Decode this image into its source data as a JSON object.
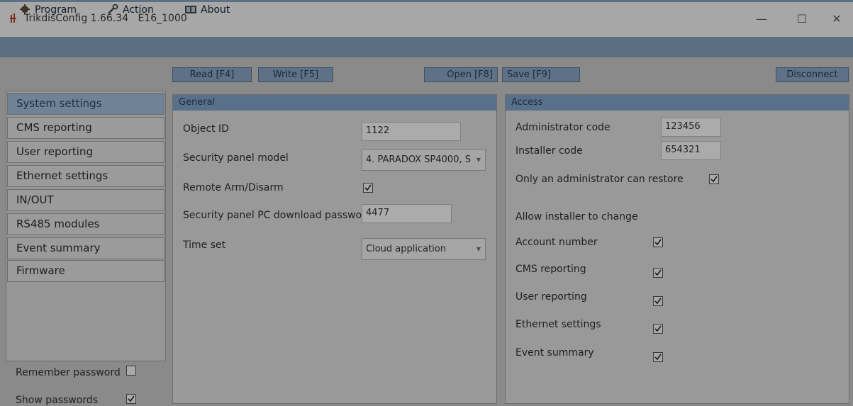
{
  "window": {
    "title": "TrikdisConfig 1.66.34",
    "device": "E16_1000",
    "minimize_glyph": "—",
    "maximize_glyph": "☐",
    "close_glyph": "✕"
  },
  "menu": {
    "program": "Program",
    "action": "Action",
    "about": "About"
  },
  "toolbar": {
    "read": "Read [F4]",
    "write": "Write [F5]",
    "open": "Open [F8]",
    "save": "Save [F9]",
    "disconnect": "Disconnect"
  },
  "nav": {
    "items": [
      "System settings",
      "CMS reporting",
      "User reporting",
      "Ethernet settings",
      "IN/OUT",
      "RS485 modules",
      "Event summary",
      "Firmware"
    ],
    "active": "System settings",
    "remember_password": "Remember password",
    "remember_password_checked": false,
    "show_passwords": "Show passwords",
    "show_passwords_checked": true
  },
  "general": {
    "title": "General",
    "object_id_label": "Object ID",
    "object_id": "1122",
    "panel_model_label": "Security panel model",
    "panel_model": "4. PARADOX SP4000, S",
    "remote_arm_label": "Remote Arm/Disarm",
    "remote_arm_checked": true,
    "pc_password_label": "Security panel PC download password",
    "pc_password": "4477",
    "time_set_label": "Time set",
    "time_set": "Cloud application"
  },
  "access": {
    "title": "Access",
    "admin_code_label": "Administrator code",
    "admin_code": "123456",
    "installer_code_label": "Installer code",
    "installer_code": "654321",
    "only_admin_restore_label": "Only an administrator can restore",
    "only_admin_restore_checked": true,
    "allow_installer_label": "Allow installer to change",
    "options": [
      {
        "label": "Account number",
        "checked": true
      },
      {
        "label": "CMS reporting",
        "checked": true
      },
      {
        "label": "User reporting",
        "checked": true
      },
      {
        "label": "Ethernet settings",
        "checked": true
      },
      {
        "label": "Event summary",
        "checked": true
      }
    ]
  },
  "colors": {
    "accent": "#5b6f83",
    "header": "#58708a",
    "active_nav": "#6f8296"
  }
}
